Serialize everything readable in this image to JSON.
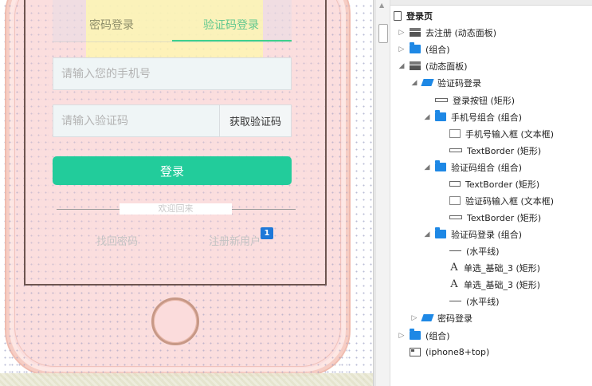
{
  "prototype": {
    "tabs": [
      {
        "label": "密码登录",
        "active": false
      },
      {
        "label": "验证码登录",
        "active": true
      }
    ],
    "phone_input": {
      "placeholder": "请输入您的手机号",
      "value": ""
    },
    "code_input": {
      "placeholder": "请输入验证码",
      "value": ""
    },
    "get_code_label": "获取验证码",
    "login_label": "登录",
    "welcome_text": "欢迎回来",
    "forgot_label": "找回密码",
    "register_label": "注册新用户",
    "note_badge": "1",
    "colors": {
      "accent": "#22cc9b",
      "tab_active": "#62c88f",
      "phone_body": "#fbdcdc",
      "badge": "#1e78d8"
    }
  },
  "outline": {
    "items": [
      {
        "icon": "page-icon",
        "toggle": "",
        "label": "登录页"
      },
      {
        "icon": "dynamic-panel-icon",
        "toggle": "▷",
        "label": "去注册 (动态面板)"
      },
      {
        "icon": "folder-icon",
        "toggle": "▷",
        "label": "(组合)"
      },
      {
        "icon": "dynamic-panel-icon",
        "toggle": "◢",
        "label": "(动态面板)"
      },
      {
        "icon": "panel-state-icon",
        "toggle": "◢",
        "label": "验证码登录"
      },
      {
        "icon": "rectangle-icon",
        "toggle": "",
        "label": "登录按钮 (矩形)"
      },
      {
        "icon": "folder-icon",
        "toggle": "◢",
        "label": "手机号组合 (组合)"
      },
      {
        "icon": "textbox-icon",
        "toggle": "",
        "label": "手机号输入框 (文本框)"
      },
      {
        "icon": "rectangle-icon",
        "toggle": "",
        "label": "TextBorder (矩形)"
      },
      {
        "icon": "folder-icon",
        "toggle": "◢",
        "label": "验证码组合 (组合)"
      },
      {
        "icon": "rectangle-icon",
        "toggle": "",
        "label": "TextBorder (矩形)"
      },
      {
        "icon": "textbox-icon",
        "toggle": "",
        "label": "验证码输入框 (文本框)"
      },
      {
        "icon": "rectangle-icon",
        "toggle": "",
        "label": "TextBorder (矩形)"
      },
      {
        "icon": "folder-icon",
        "toggle": "◢",
        "label": "验证码登录 (组合)"
      },
      {
        "icon": "horizontal-line-icon",
        "toggle": "",
        "label": "(水平线)"
      },
      {
        "icon": "text-icon",
        "toggle": "",
        "label": "单选_基础_3 (矩形)"
      },
      {
        "icon": "text-icon",
        "toggle": "",
        "label": "单选_基础_3 (矩形)"
      },
      {
        "icon": "horizontal-line-icon",
        "toggle": "",
        "label": "(水平线)"
      },
      {
        "icon": "panel-state-icon",
        "toggle": "▷",
        "label": "密码登录"
      },
      {
        "icon": "folder-icon",
        "toggle": "▷",
        "label": "(组合)"
      },
      {
        "icon": "image-icon",
        "toggle": "",
        "label": "(iphone8+top)"
      }
    ]
  }
}
